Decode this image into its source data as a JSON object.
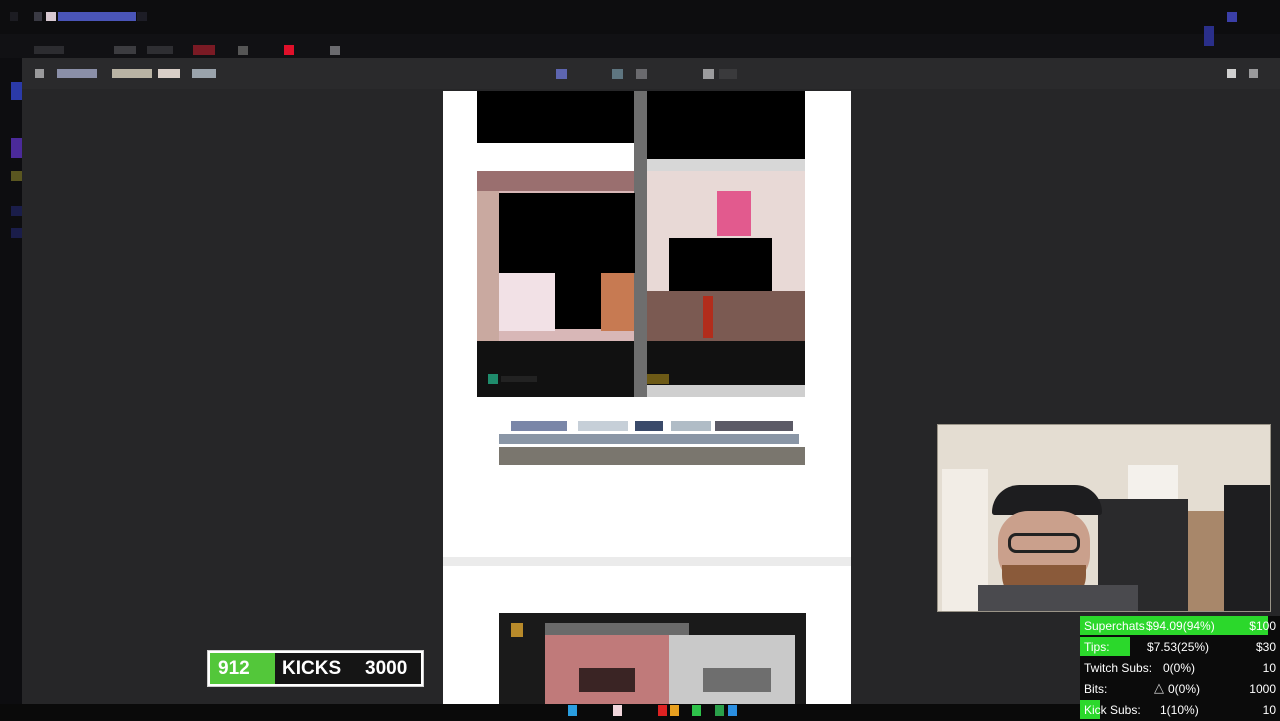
{
  "kick_counter": {
    "current": "912",
    "label": "KICKS",
    "goal": "3000",
    "progress_fraction": 0.304
  },
  "donation_goals": [
    {
      "label": "Superchats",
      "value": "$94.09(94%)",
      "target": "$100",
      "fraction": 0.94
    },
    {
      "label": "Tips:",
      "value": "$7.53(25%)",
      "target": "$30",
      "fraction": 0.25
    },
    {
      "label": "Twitch Subs:",
      "value": "0(0%)",
      "target": "10",
      "fraction": 0.0
    },
    {
      "label": "Bits:",
      "value": "0(0%)",
      "target": "1000",
      "fraction": 0.0
    },
    {
      "label": "Kick Subs:",
      "value": "1(10%)",
      "target": "10",
      "fraction": 0.1
    }
  ],
  "colors": {
    "kick_green": "#53c73a",
    "goal_green": "#2bd82b",
    "app_background": "#262628",
    "toolbar": "#2a2a2c",
    "page_white": "#ffffff"
  },
  "icons": {
    "bits": "triangle-outline-icon",
    "window_controls": [
      "minimize-icon",
      "close-icon"
    ]
  }
}
